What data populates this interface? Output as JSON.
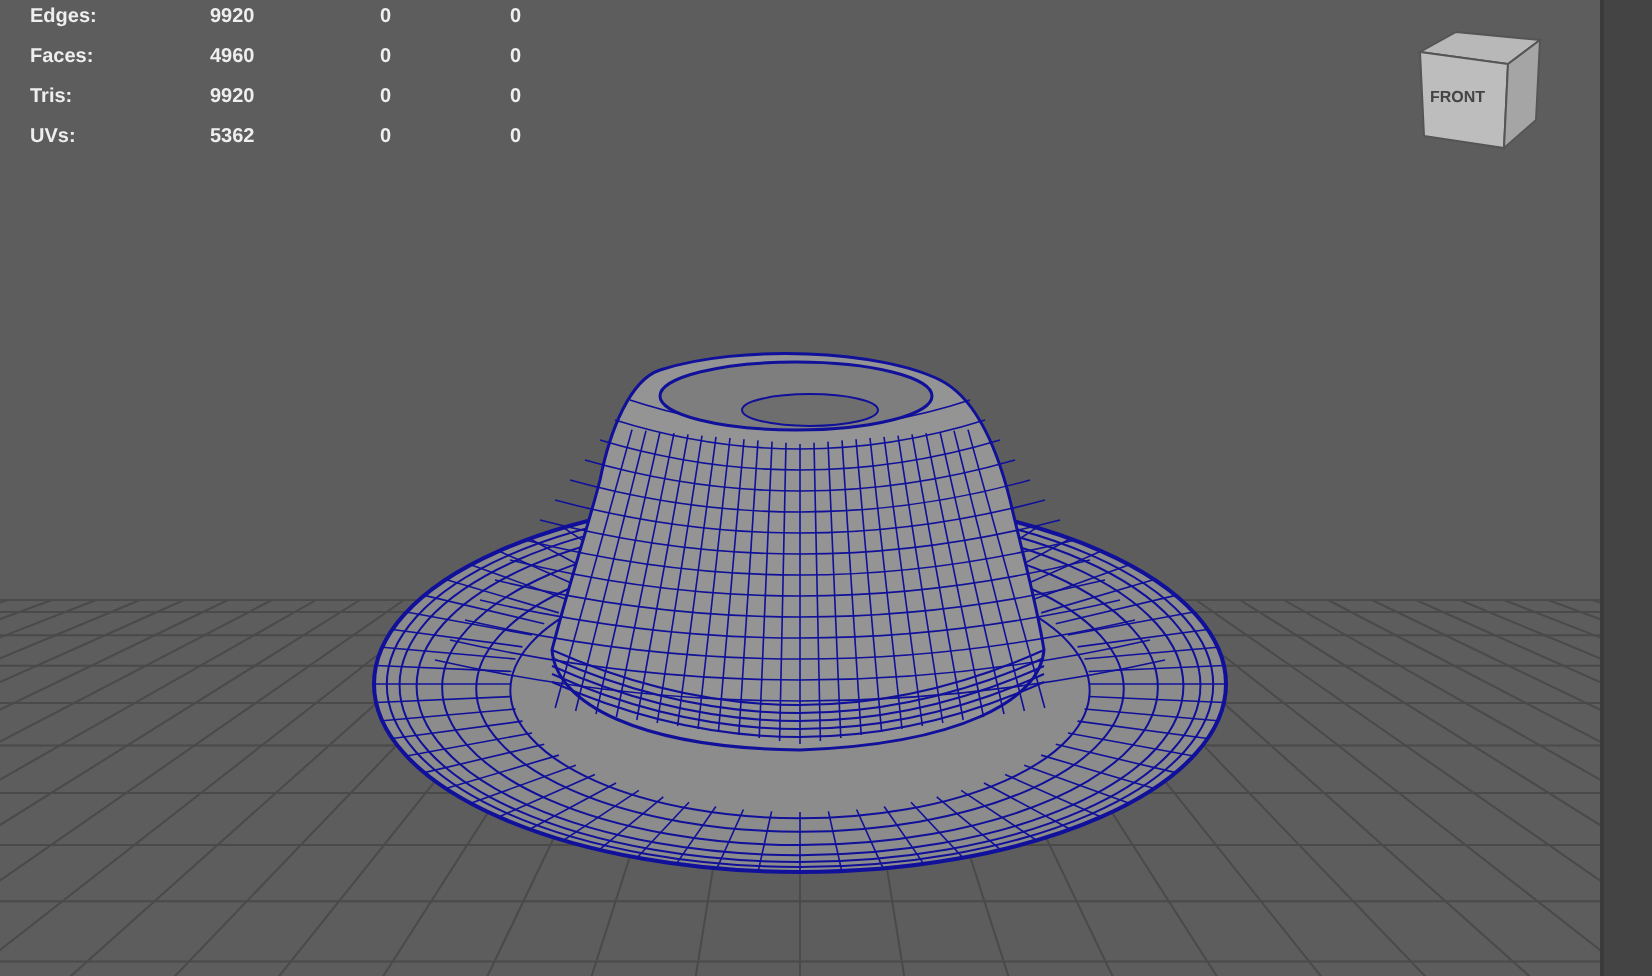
{
  "stats": [
    {
      "label": "Edges:",
      "values": [
        "9920",
        "0",
        "0"
      ]
    },
    {
      "label": "Faces:",
      "values": [
        "4960",
        "0",
        "0"
      ]
    },
    {
      "label": "Tris:",
      "values": [
        "9920",
        "0",
        "0"
      ]
    },
    {
      "label": "UVs:",
      "values": [
        "5362",
        "0",
        "0"
      ]
    }
  ],
  "view_cube": {
    "label": "FRONT"
  }
}
